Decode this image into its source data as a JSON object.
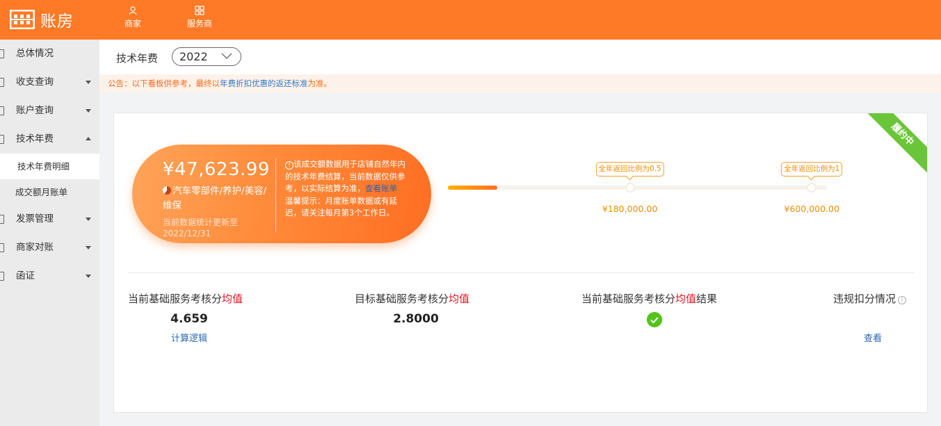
{
  "app": {
    "name": "账房"
  },
  "topnav": [
    {
      "label": "商家",
      "icon": "user-icon"
    },
    {
      "label": "服务商",
      "icon": "grid-icon"
    }
  ],
  "sidebar": {
    "items": [
      {
        "label": "总体情况",
        "caret": false
      },
      {
        "label": "收支查询",
        "caret": "down"
      },
      {
        "label": "账户查询",
        "caret": "down"
      },
      {
        "label": "技术年费",
        "caret": "up",
        "children": [
          {
            "label": "技术年费明细",
            "active": true
          },
          {
            "label": "成交额月账单",
            "active": false
          }
        ]
      },
      {
        "label": "发票管理",
        "caret": "down"
      },
      {
        "label": "商家对账",
        "caret": "down"
      },
      {
        "label": "函证",
        "caret": "down"
      }
    ]
  },
  "header": {
    "title": "技术年费",
    "year": "2022"
  },
  "notice": {
    "prefix": "公告：以下看板供参考，最终以",
    "highlight": "年费折扣优惠的返还标准",
    "suffix": "为准。"
  },
  "card": {
    "status": "履约中",
    "amount": "¥47,623.99",
    "category": "汽车零部件/养护/美容/维保",
    "update_note": "当前数据统计更新至2022/12/31",
    "desc_info_symbol": "!",
    "desc_main": "该成交额数据用于店铺自然年内的技术年费结算，当前数据仅供参考，以实际结算为准，",
    "desc_link": "查看账单",
    "desc_tip": "温馨提示：月度账单数据或有延迟，请关注每月第3个工作日。",
    "progress": {
      "current": 47623.99,
      "fill_fraction": 0.13
    },
    "milestones": [
      {
        "tip": "全年返回比例为0.5",
        "amount": "¥180,000.00",
        "position": 0.48
      },
      {
        "tip": "全年返回比例为1",
        "amount": "¥600,000.00",
        "position": 0.96
      }
    ],
    "metrics": [
      {
        "label_pre": "当前基础服务考核分",
        "label_red": "均值",
        "label_post": "",
        "value": "4.659",
        "link": "计算逻辑"
      },
      {
        "label_pre": "目标基础服务考核分",
        "label_red": "均值",
        "label_post": "",
        "value": "2.8000"
      },
      {
        "label_pre": "当前基础服务考核分",
        "label_red": "均值",
        "label_post": "结果",
        "result": "pass"
      },
      {
        "label_pre": "违规扣分情况",
        "info_symbol": "i",
        "link": "查看"
      }
    ]
  },
  "colors": {
    "brand": "#ff7a26",
    "accent_red": "#e5131d",
    "link": "#2868b5",
    "success": "#52c41a",
    "milestone": "#f08c00"
  }
}
